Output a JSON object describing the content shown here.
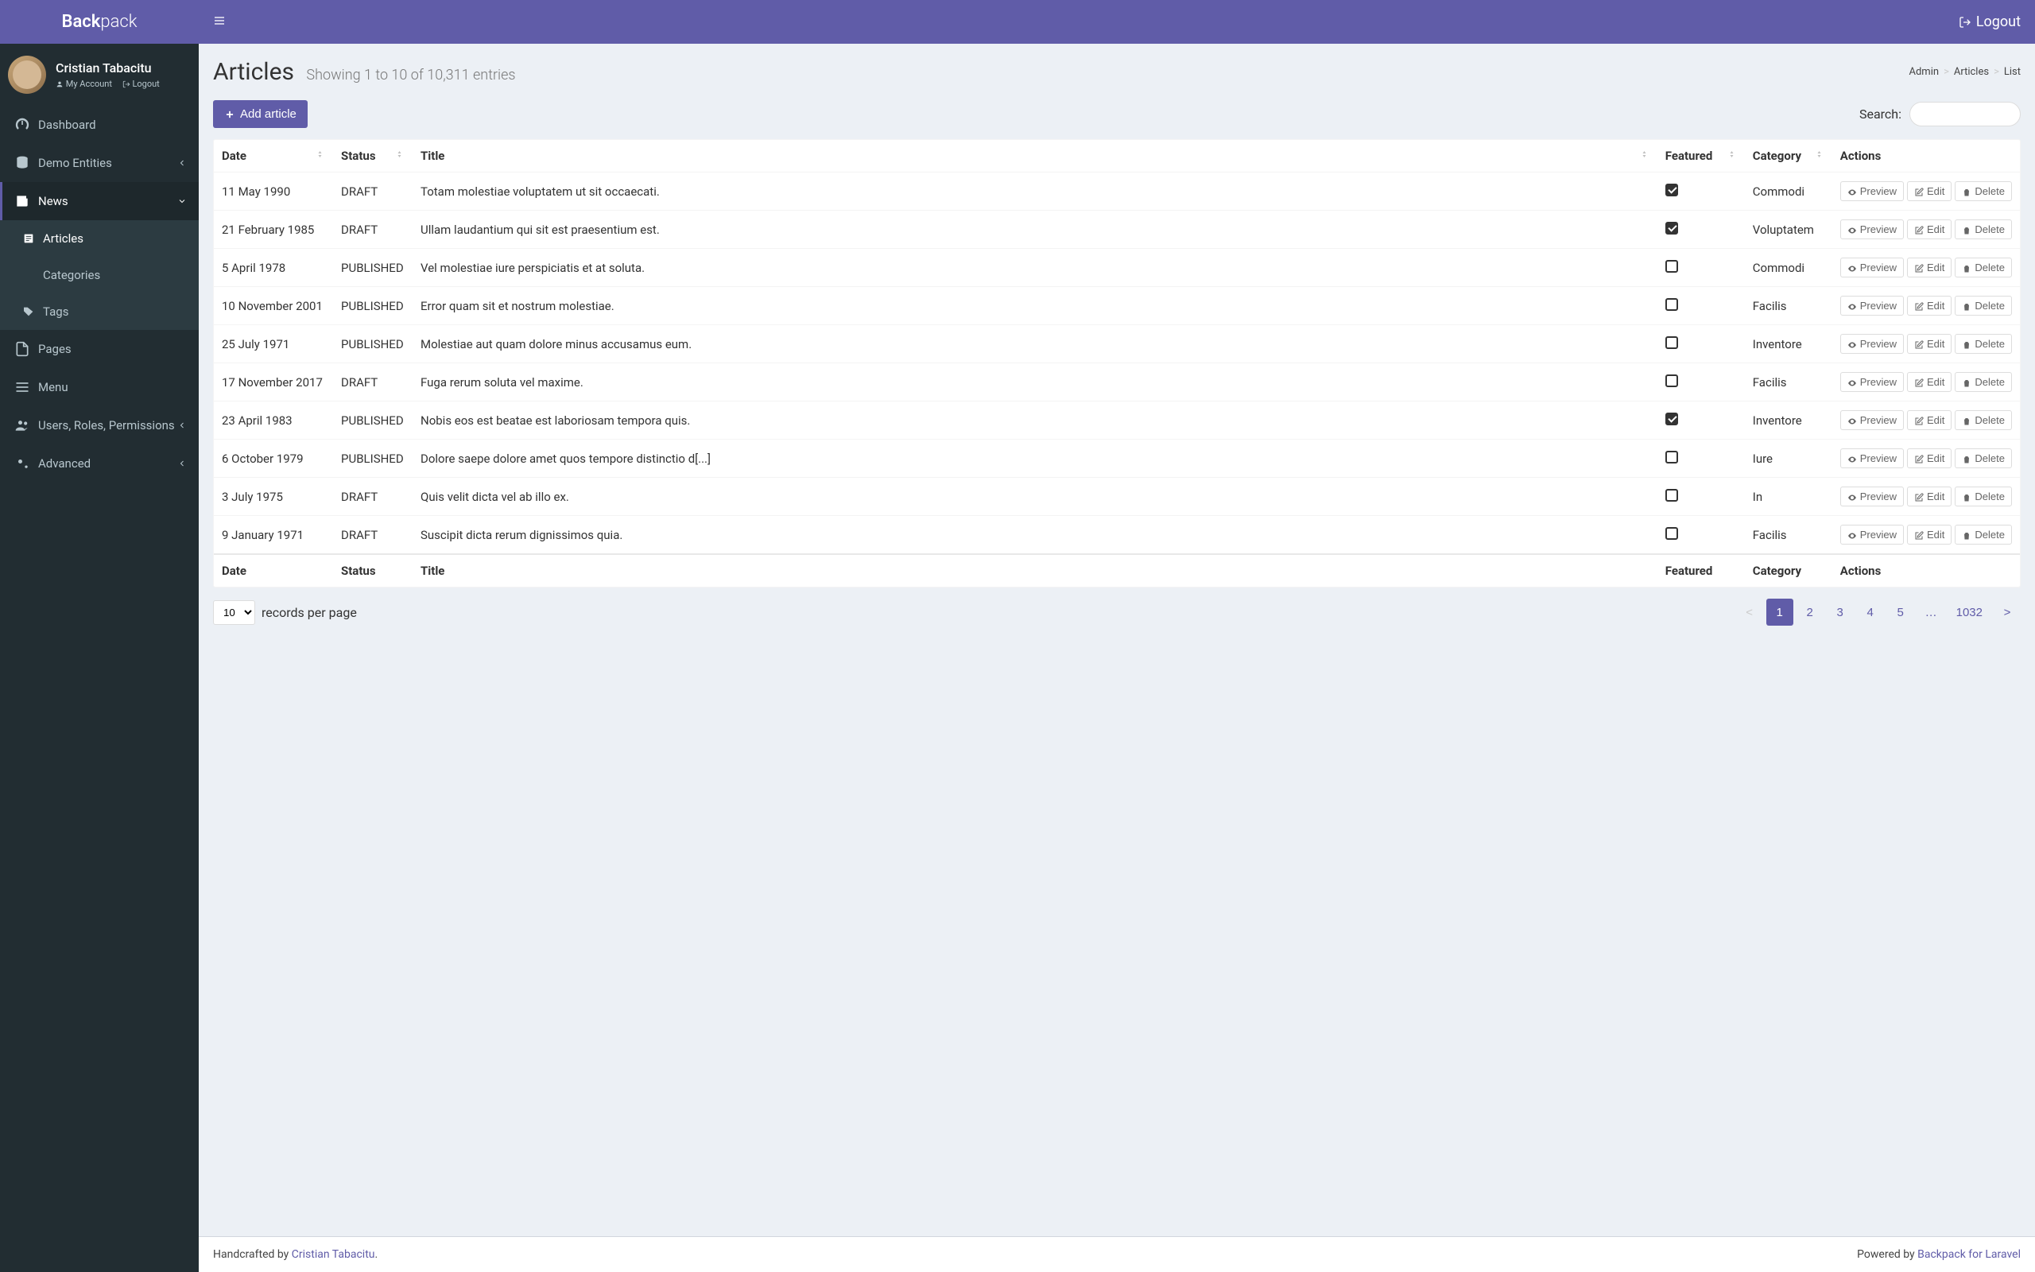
{
  "brand": {
    "prefix": "Back",
    "suffix": "pack"
  },
  "user": {
    "name": "Cristian Tabacitu",
    "links": {
      "account": "My Account",
      "logout": "Logout"
    }
  },
  "topbar": {
    "logout": "Logout"
  },
  "sidebar": {
    "items": [
      {
        "label": "Dashboard",
        "icon": "dashboard-icon"
      },
      {
        "label": "Demo Entities",
        "icon": "database-icon",
        "expandable": true
      },
      {
        "label": "News",
        "icon": "news-icon",
        "expandable": true,
        "open": true,
        "children": [
          {
            "label": "Articles",
            "icon": "article-icon",
            "selected": true
          },
          {
            "label": "Categories",
            "icon": "list-icon"
          },
          {
            "label": "Tags",
            "icon": "tag-icon"
          }
        ]
      },
      {
        "label": "Pages",
        "icon": "file-icon"
      },
      {
        "label": "Menu",
        "icon": "menu-icon"
      },
      {
        "label": "Users, Roles, Permissions",
        "icon": "users-icon",
        "expandable": true
      },
      {
        "label": "Advanced",
        "icon": "gears-icon",
        "expandable": true
      }
    ]
  },
  "breadcrumb": {
    "items": [
      "Admin",
      "Articles",
      "List"
    ]
  },
  "page": {
    "title": "Articles",
    "subtitle": "Showing 1 to 10 of 10,311 entries"
  },
  "toolbar": {
    "add_label": "Add article",
    "search_label": "Search:",
    "search_value": ""
  },
  "table": {
    "columns": [
      "Date",
      "Status",
      "Title",
      "Featured",
      "Category",
      "Actions"
    ],
    "rows": [
      {
        "date": "11 May 1990",
        "status": "DRAFT",
        "title": "Totam molestiae voluptatem ut sit occaecati.",
        "featured": true,
        "category": "Commodi"
      },
      {
        "date": "21 February 1985",
        "status": "DRAFT",
        "title": "Ullam laudantium qui sit est praesentium est.",
        "featured": true,
        "category": "Voluptatem"
      },
      {
        "date": "5 April 1978",
        "status": "PUBLISHED",
        "title": "Vel molestiae iure perspiciatis et at soluta.",
        "featured": false,
        "category": "Commodi"
      },
      {
        "date": "10 November 2001",
        "status": "PUBLISHED",
        "title": "Error quam sit et nostrum molestiae.",
        "featured": false,
        "category": "Facilis"
      },
      {
        "date": "25 July 1971",
        "status": "PUBLISHED",
        "title": "Molestiae aut quam dolore minus accusamus eum.",
        "featured": false,
        "category": "Inventore"
      },
      {
        "date": "17 November 2017",
        "status": "DRAFT",
        "title": "Fuga rerum soluta vel maxime.",
        "featured": false,
        "category": "Facilis"
      },
      {
        "date": "23 April 1983",
        "status": "PUBLISHED",
        "title": "Nobis eos est beatae est laboriosam tempora quis.",
        "featured": true,
        "category": "Inventore"
      },
      {
        "date": "6 October 1979",
        "status": "PUBLISHED",
        "title": "Dolore saepe dolore amet quos tempore distinctio d[...]",
        "featured": false,
        "category": "Iure"
      },
      {
        "date": "3 July 1975",
        "status": "DRAFT",
        "title": "Quis velit dicta vel ab illo ex.",
        "featured": false,
        "category": "In"
      },
      {
        "date": "9 January 1971",
        "status": "DRAFT",
        "title": "Suscipit dicta rerum dignissimos quia.",
        "featured": false,
        "category": "Facilis"
      }
    ],
    "actions": {
      "preview": "Preview",
      "edit": "Edit",
      "delete": "Delete"
    }
  },
  "pagination": {
    "per_page": "10",
    "per_page_label": "records per page",
    "pages": [
      "<",
      "1",
      "2",
      "3",
      "4",
      "5",
      "…",
      "1032",
      ">"
    ],
    "current": "1"
  },
  "footer": {
    "left_prefix": "Handcrafted by ",
    "left_link": "Cristian Tabacitu",
    "left_suffix": ".",
    "right_prefix": "Powered by ",
    "right_link": "Backpack for Laravel"
  }
}
